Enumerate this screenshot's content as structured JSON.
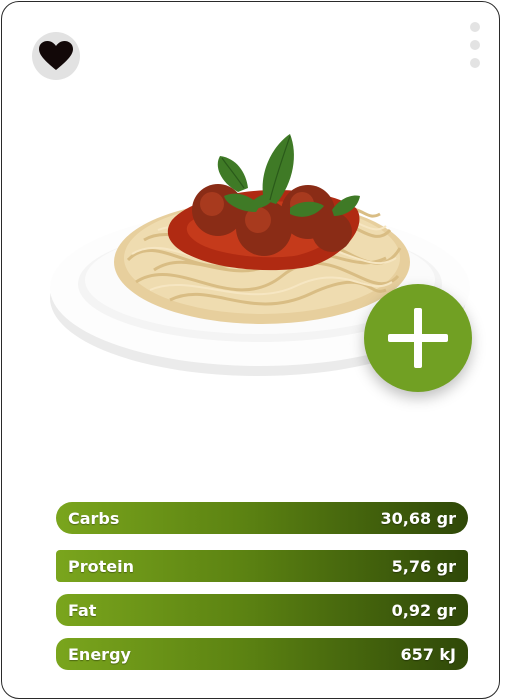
{
  "card": {
    "favorite_icon": "heart-icon",
    "menu_icon": "kebab-menu-icon",
    "dish_image": "spaghetti-meatballs-image",
    "add_icon": "plus-icon"
  },
  "colors": {
    "accent": "#71a023",
    "pill_start": "#7aa51d",
    "pill_end": "#2f4808"
  },
  "nutrition": [
    {
      "label": "Carbs",
      "value": "30,68 gr"
    },
    {
      "label": "Protein",
      "value": "5,76 gr"
    },
    {
      "label": "Fat",
      "value": "0,92 gr"
    },
    {
      "label": "Energy",
      "value": "657 kJ"
    }
  ]
}
